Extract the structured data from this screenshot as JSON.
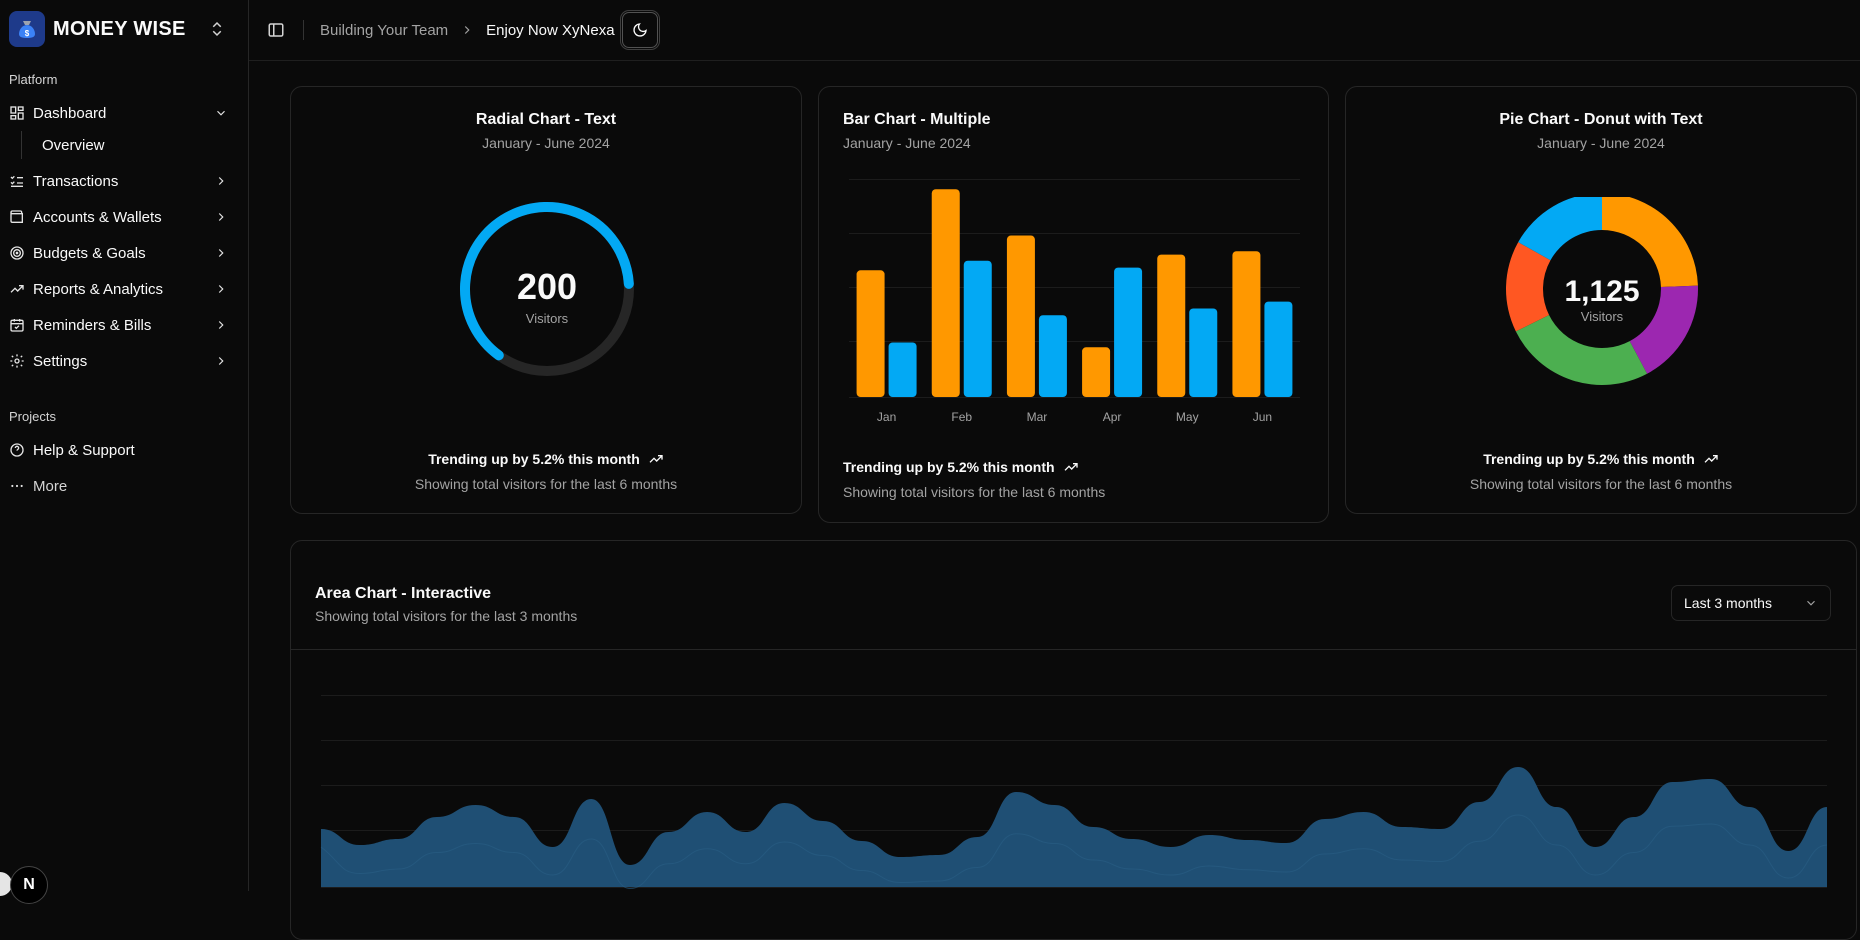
{
  "app": {
    "name": "MONEY WISE"
  },
  "sidebar": {
    "platform_label": "Platform",
    "projects_label": "Projects",
    "items": [
      {
        "label": "Dashboard",
        "icon": "dashboard-icon"
      },
      {
        "label": "Transactions",
        "icon": "list-check-icon"
      },
      {
        "label": "Accounts & Wallets",
        "icon": "wallet-icon"
      },
      {
        "label": "Budgets & Goals",
        "icon": "target-icon"
      },
      {
        "label": "Reports & Analytics",
        "icon": "trending-icon"
      },
      {
        "label": "Reminders & Bills",
        "icon": "calendar-icon"
      },
      {
        "label": "Settings",
        "icon": "gear-icon"
      }
    ],
    "dashboard_sub": [
      "Overview"
    ],
    "projects": [
      {
        "label": "Help & Support",
        "icon": "help-icon"
      },
      {
        "label": "More",
        "icon": "more-icon"
      }
    ]
  },
  "header": {
    "breadcrumb": [
      "Building Your Team",
      "Enjoy Now XyNexa"
    ]
  },
  "cards": {
    "radial": {
      "title": "Radial Chart - Text",
      "subtitle": "January - June 2024",
      "value": "200",
      "value_label": "Visitors",
      "trend": "Trending up by 5.2% this month",
      "footer": "Showing total visitors for the last 6 months"
    },
    "bar": {
      "title": "Bar Chart - Multiple",
      "subtitle": "January - June 2024",
      "trend": "Trending up by 5.2% this month",
      "footer": "Showing total visitors for the last 6 months"
    },
    "pie": {
      "title": "Pie Chart - Donut with Text",
      "subtitle": "January - June 2024",
      "value": "1,125",
      "value_label": "Visitors",
      "trend": "Trending up by 5.2% this month",
      "footer": "Showing total visitors for the last 6 months"
    },
    "area": {
      "title": "Area Chart - Interactive",
      "subtitle": "Showing total visitors for the last 3 months",
      "range_select": "Last 3 months"
    }
  },
  "colors": {
    "orange": "#ff9800",
    "blue": "#03a9f4",
    "red": "#ff5722",
    "green": "#4caf50",
    "purple": "#9c27b0",
    "area_fill": "#1f4f74"
  },
  "chart_data": [
    {
      "type": "radial",
      "value": 200,
      "fraction": 0.64
    },
    {
      "type": "bar",
      "categories": [
        "Jan",
        "Feb",
        "Mar",
        "Apr",
        "May",
        "Jun"
      ],
      "series": [
        {
          "values": [
            186,
            305,
            237,
            73,
            209,
            214
          ]
        },
        {
          "values": [
            80,
            200,
            120,
            190,
            130,
            140
          ]
        }
      ],
      "ylim": [
        0,
        320
      ]
    },
    {
      "type": "pie",
      "total": 1125,
      "values": [
        275,
        200,
        287,
        173,
        190
      ],
      "order": [
        "orange",
        "purple",
        "green",
        "red",
        "blue"
      ]
    },
    {
      "type": "area",
      "values": [
        58,
        42,
        48,
        70,
        82,
        70,
        40,
        88,
        22,
        55,
        75,
        55,
        84,
        66,
        46,
        30,
        32,
        50,
        95,
        82,
        60,
        48,
        40,
        52,
        47,
        44,
        68,
        75,
        60,
        58,
        85,
        120,
        80,
        40,
        70,
        105,
        108,
        80,
        36,
        80
      ]
    }
  ]
}
